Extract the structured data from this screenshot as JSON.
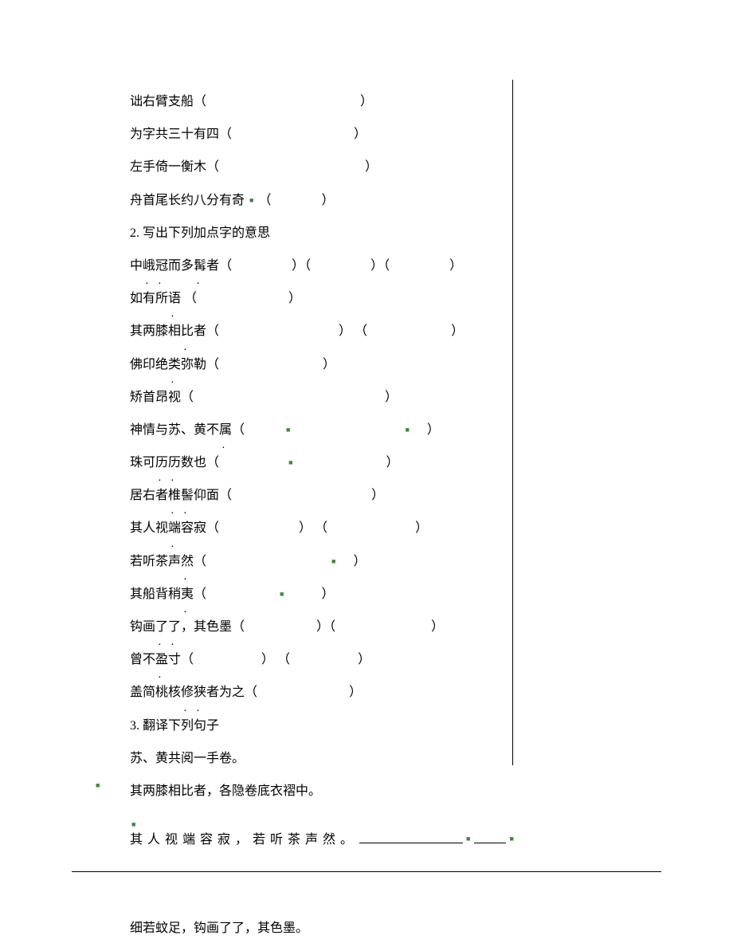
{
  "section1": {
    "l1": {
      "pre": "诎右臂支船（",
      "close": "）"
    },
    "l2": {
      "pre": "为字共三十有四（",
      "close": "）"
    },
    "l3": {
      "pre": "左手倚一衡木（",
      "close": "）"
    },
    "l4": {
      "pre": "舟首尾长约八分有奇",
      "open": "（",
      "close": "）"
    }
  },
  "section2": {
    "heading": "2. 写出下列加点字的意思",
    "l1": {
      "a": "中",
      "d1": "峨冠",
      "b": "而多",
      "d2": "髯",
      "c": "者（",
      "close1": "）（",
      "close2": "）（",
      "close3": "）"
    },
    "l2": {
      "a": "如有所",
      "d1": "语",
      "open": "（",
      "close": "）"
    },
    "l3": {
      "a": "其两膝相",
      "d1": "比",
      "b": "者（",
      "close1": "） （",
      "close2": "）"
    },
    "l4": {
      "a": "佛印绝",
      "d1": "类",
      "b": "弥勒（",
      "close": "）"
    },
    "l5": {
      "a": "矫首昂视（",
      "close": "）"
    },
    "l6": {
      "a": "神情与苏、黄不",
      "d1": "属",
      "open": "（",
      "close": "）"
    },
    "l7": {
      "a": "珠可",
      "d1": "历历",
      "b": "数也（",
      "close": "）"
    },
    "l8": {
      "a": "居右者",
      "d1": "椎髻",
      "b": "仰面（",
      "close": "）"
    },
    "l9": {
      "a": "其人视",
      "d1": "端",
      "b": "容寂（",
      "close1": "） （",
      "close2": "）"
    },
    "l10": {
      "a": "若听茶声",
      "d1": "然",
      "open": "（",
      "close": "）"
    },
    "l11": {
      "a": "其船背稍",
      "d1": "夷",
      "open": "（",
      "close": "）"
    },
    "l12": {
      "a": "钩画",
      "d1": "了了",
      "comma": "，其色墨（",
      "close1": "）（",
      "close2": "）"
    },
    "l13": {
      "a": "曾不",
      "d1": "盈",
      "b": "寸（",
      "close1": "） （",
      "close2": "）"
    },
    "l14": {
      "a": "盖简桃核",
      "d1": "修狭",
      "b": "者为之（",
      "close": "）"
    }
  },
  "section3": {
    "heading": "3. 翻译下列句子",
    "l1": "苏、黄共阅一手卷。",
    "l2": "其两膝相比者，各隐卷底衣褶中。",
    "l3_a": "其 人 视 端 容 寂 ， 若 听 茶 声 然 。",
    "l4": "细若蚊足，钩画了了，其色墨。"
  }
}
